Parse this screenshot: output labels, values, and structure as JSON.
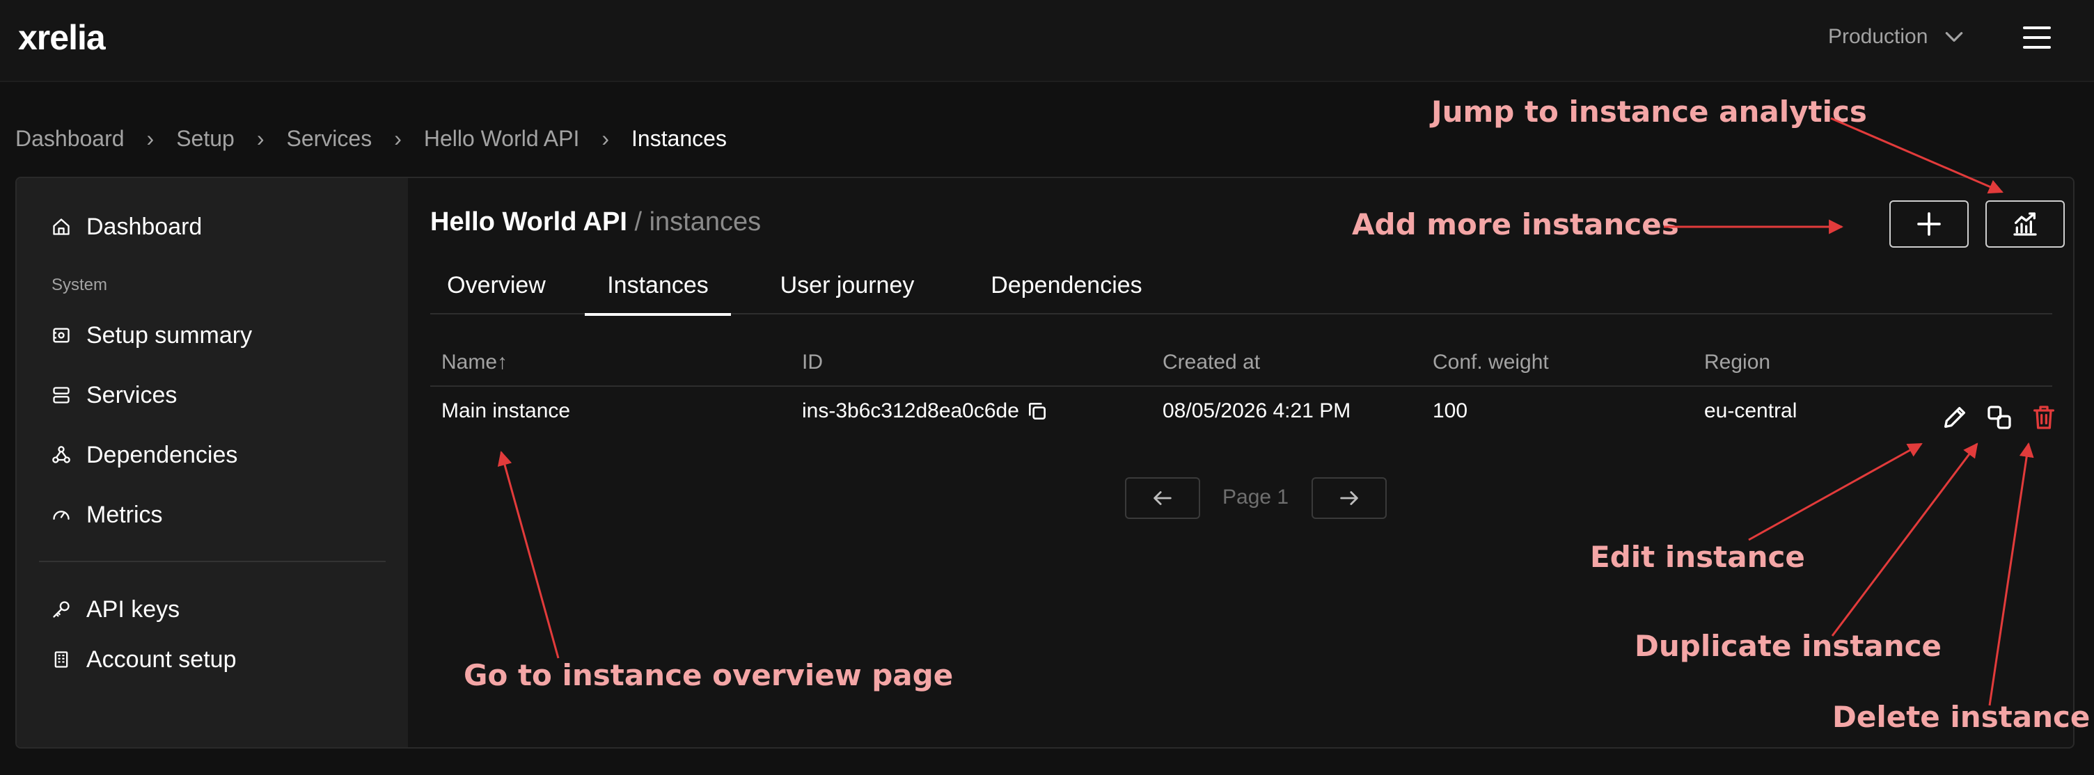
{
  "app": {
    "logo": "xrelia",
    "environment": "Production"
  },
  "breadcrumb": [
    "Dashboard",
    "Setup",
    "Services",
    "Hello World API",
    "Instances"
  ],
  "sidebar": {
    "items": [
      {
        "label": "Dashboard",
        "icon": "home-icon"
      },
      {
        "label": "Setup summary",
        "icon": "setup-summary-icon"
      },
      {
        "label": "Services",
        "icon": "services-icon"
      },
      {
        "label": "Dependencies",
        "icon": "dependencies-icon"
      },
      {
        "label": "Metrics",
        "icon": "gauge-icon"
      },
      {
        "label": "API keys",
        "icon": "key-icon"
      },
      {
        "label": "Account setup",
        "icon": "building-icon"
      }
    ],
    "section_system": "System"
  },
  "page": {
    "title": "Hello World API",
    "subtitle": "/ instances"
  },
  "tabs": [
    {
      "label": "Overview",
      "active": false
    },
    {
      "label": "Instances",
      "active": true
    },
    {
      "label": "User journey",
      "active": false
    },
    {
      "label": "Dependencies",
      "active": false
    }
  ],
  "table": {
    "columns": [
      "Name",
      "ID",
      "Created at",
      "Conf. weight",
      "Region"
    ],
    "sort_indicator": "↑",
    "rows": [
      {
        "name": "Main instance",
        "id": "ins-3b6c312d8ea0c6de",
        "created_at": "08/05/2026 4:21 PM",
        "weight": "100",
        "region": "eu-central"
      }
    ]
  },
  "pagination": {
    "label": "Page 1"
  },
  "colors": {
    "annotation": "#f4a6a6",
    "arrow": "#e23b3b",
    "delete": "#e23b3b"
  },
  "annotations": {
    "analytics": "Jump to instance analytics",
    "add": "Add more instances",
    "edit": "Edit instance",
    "duplicate": "Duplicate instance",
    "delete": "Delete instance",
    "overview": "Go to instance overview page"
  }
}
